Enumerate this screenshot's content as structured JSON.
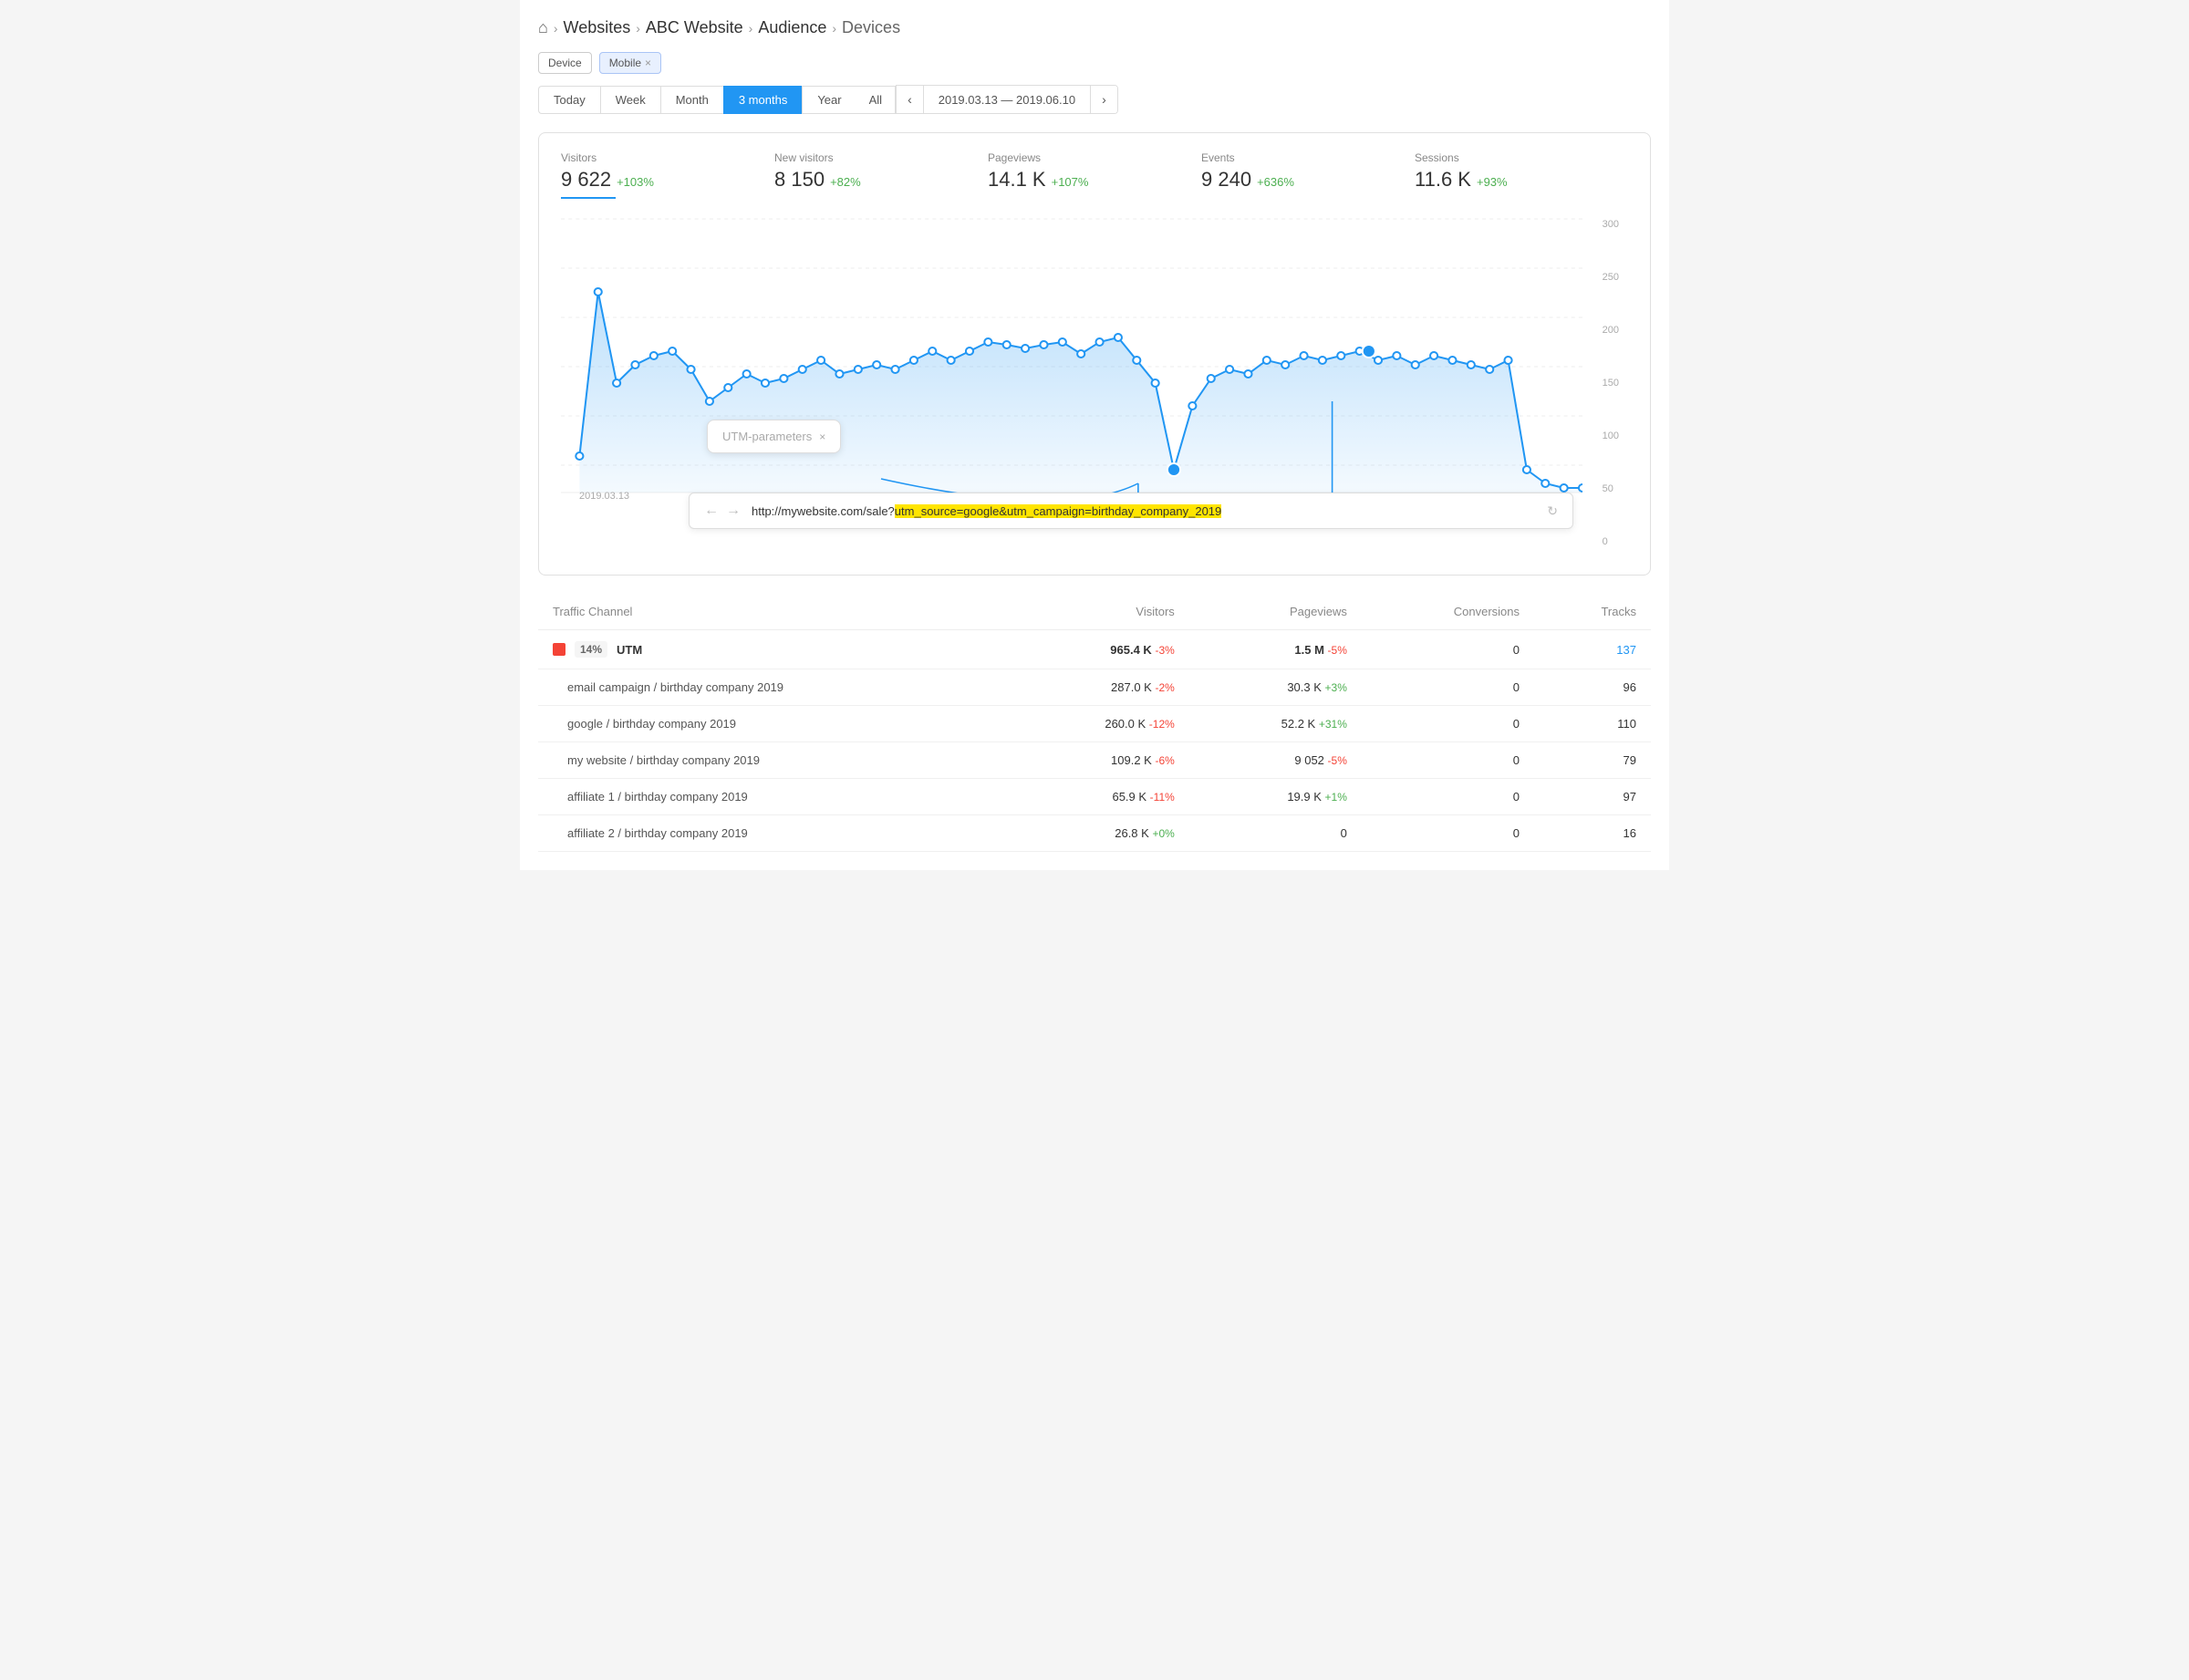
{
  "breadcrumb": {
    "home": "⌂",
    "items": [
      "Websites",
      "ABC Website",
      "Audience",
      "Devices"
    ]
  },
  "filters": {
    "tags": [
      {
        "label": "Device",
        "closable": false
      },
      {
        "label": "Mobile",
        "closable": true
      }
    ]
  },
  "dateControls": {
    "buttons": [
      "Today",
      "Week",
      "Month",
      "3 months",
      "Year",
      "All"
    ],
    "activeButton": "3 months",
    "dateRange": "2019.03.13 — 2019.06.10"
  },
  "stats": {
    "items": [
      {
        "label": "Visitors",
        "value": "9 622",
        "change": "+103%"
      },
      {
        "label": "New visitors",
        "value": "8 150",
        "change": "+82%"
      },
      {
        "label": "Pageviews",
        "value": "14.1 K",
        "change": "+107%"
      },
      {
        "label": "Events",
        "value": "9 240",
        "change": "+636%"
      },
      {
        "label": "Sessions",
        "value": "11.6 K",
        "change": "+93%"
      }
    ]
  },
  "chart": {
    "xLabel": "2019.03.13",
    "yLabels": [
      "300",
      "250",
      "200",
      "150",
      "100",
      "50",
      "0"
    ]
  },
  "utmTooltip": {
    "label": "UTM-parameters",
    "closeIcon": "×"
  },
  "urlBar": {
    "url": "http://mywebsite.com/sale?",
    "highlighted": "utm_source=google&utm_campaign=birthday_company_2019",
    "refreshIcon": "↻"
  },
  "table": {
    "headers": [
      "Traffic Channel",
      "Visitors",
      "Pageviews",
      "Conversions",
      "Tracks"
    ],
    "rows": [
      {
        "type": "main",
        "color": "#F44336",
        "percent": "14%",
        "channel": "UTM",
        "visitors": "965.4 K",
        "visitorsChange": "-3%",
        "pageviews": "1.5 M",
        "pageviewsChange": "-5%",
        "conversions": "0",
        "tracks": "137",
        "tracksBlue": true
      },
      {
        "type": "sub",
        "channel": "email campaign / birthday company 2019",
        "visitors": "287.0 K",
        "visitorsChange": "-2%",
        "pageviews": "30.3 K",
        "pageviewsChange": "+3%",
        "conversions": "0",
        "tracks": "96"
      },
      {
        "type": "sub",
        "channel": "google / birthday company 2019",
        "visitors": "260.0 K",
        "visitorsChange": "-12%",
        "pageviews": "52.2 K",
        "pageviewsChange": "+31%",
        "conversions": "0",
        "tracks": "110"
      },
      {
        "type": "sub",
        "channel": "my website / birthday company 2019",
        "visitors": "109.2 K",
        "visitorsChange": "-6%",
        "pageviews": "9 052",
        "pageviewsChange": "-5%",
        "conversions": "0",
        "tracks": "79"
      },
      {
        "type": "sub",
        "channel": "affiliate 1 / birthday company 2019",
        "visitors": "65.9 K",
        "visitorsChange": "-11%",
        "pageviews": "19.9 K",
        "pageviewsChange": "+1%",
        "conversions": "0",
        "tracks": "97"
      },
      {
        "type": "sub",
        "channel": "affiliate 2 / birthday company 2019",
        "visitors": "26.8 K",
        "visitorsChange": "+0%",
        "pageviews": "0",
        "pageviewsChange": "",
        "conversions": "0",
        "tracks": "16"
      }
    ]
  }
}
